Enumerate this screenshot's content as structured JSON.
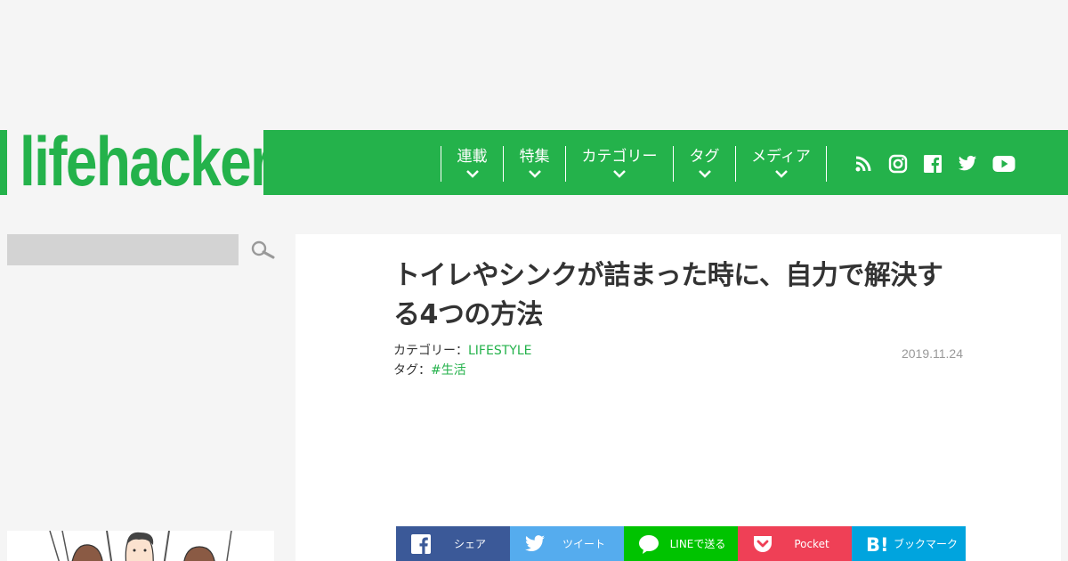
{
  "header": {
    "logo_text": "lifehacker",
    "brand_color": "#24b24b",
    "nav": [
      {
        "label": "連載"
      },
      {
        "label": "特集"
      },
      {
        "label": "カテゴリー"
      },
      {
        "label": "タグ"
      },
      {
        "label": "メディア"
      }
    ],
    "social_icons": [
      "rss-icon",
      "instagram-icon",
      "facebook-icon",
      "twitter-icon",
      "youtube-icon"
    ]
  },
  "search": {
    "placeholder": ""
  },
  "article": {
    "title": "トイレやシンクが詰まった時に、自力で解決する4つの方法",
    "category_prefix": "カテゴリー：",
    "category": "LIFESTYLE",
    "tag_prefix": "タグ：",
    "tag": "#生活",
    "date": "2019.11.24"
  },
  "share_buttons": [
    {
      "label": "シェア",
      "icon": "facebook-icon",
      "color": "#3b5998"
    },
    {
      "label": "ツイート",
      "icon": "twitter-icon",
      "color": "#55acee"
    },
    {
      "label": "LINEで送る",
      "icon": "line-icon",
      "color": "#00c300"
    },
    {
      "label": "Pocket",
      "icon": "pocket-icon",
      "color": "#ef4056"
    },
    {
      "label": "ブックマーク",
      "icon": "hatena-bookmark-icon",
      "color": "#00a4de"
    }
  ]
}
